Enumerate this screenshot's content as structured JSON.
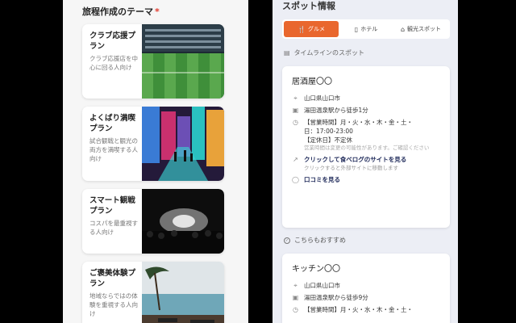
{
  "left": {
    "section_title": "旅程作成のテーマ",
    "required_mark": "*",
    "plans": [
      {
        "title": "クラブ応援プラン",
        "desc": "クラブ応援店を中心に回る人向け",
        "image_icon": "stadium-photo"
      },
      {
        "title": "よくばり満喫プラン",
        "desc": "試合観戦と観光の両方を満喫する人向け",
        "image_icon": "city-street-photo"
      },
      {
        "title": "スマート観戦プラン",
        "desc": "コスパを最重視する人向け",
        "image_icon": "concert-crowd-photo"
      },
      {
        "title": "ご褒美体験プラン",
        "desc": "地域ならではの体験を重視する人向け",
        "image_icon": "resort-pool-photo"
      }
    ]
  },
  "right": {
    "panel_title": "スポット情報",
    "tabs": [
      {
        "label": "グルメ",
        "icon": "fork-knife-icon",
        "active": true
      },
      {
        "label": "ホテル",
        "icon": "hotel-icon",
        "active": false
      },
      {
        "label": "観光スポット",
        "icon": "landmark-icon",
        "active": false
      }
    ],
    "timeline_label": "タイムラインのスポット",
    "spot1": {
      "name": "居酒屋〇〇",
      "address": "山口県山口市",
      "access": "湯田温泉駅から徒歩1分",
      "hours_line1": "【営業時間】月・火・水・木・金・土・",
      "hours_line2": "日：17:00-23:00",
      "closed": "【定休日】不定休",
      "note": "営業時間は変更の可能性があります。ご確認ください",
      "link_label": "クリックして食べログのサイトを見る",
      "link_sub": "クリックすると外部サイトに移動します",
      "review_label": "口コミを見る"
    },
    "recommend_label": "こちらもおすすめ",
    "spot2": {
      "name": "キッチン〇〇",
      "address": "山口県山口市",
      "access": "湯田温泉駅から徒歩9分",
      "hours_line1": "【営業時間】月・火・水・木・金・土・"
    },
    "accent_color": "#e9672e"
  }
}
